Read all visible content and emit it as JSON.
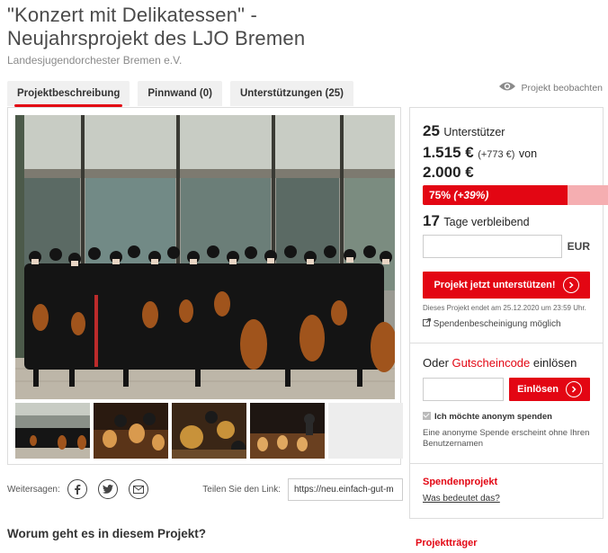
{
  "project": {
    "title_line1": "\"Konzert mit Delikatessen\" -",
    "title_line2": "Neujahrsprojekt des LJO Bremen",
    "organization": "Landesjugendorchester Bremen e.V."
  },
  "tabs": [
    {
      "label": "Projektbeschreibung",
      "active": true
    },
    {
      "label": "Pinnwand (0)",
      "active": false
    },
    {
      "label": "Unterstützungen (25)",
      "active": false
    }
  ],
  "watch": {
    "label": "Projekt beobachten",
    "icon": "eye-icon"
  },
  "stats": {
    "supporters_count": "25",
    "supporters_label": "Unterstützer",
    "amount": "1.515 €",
    "amount_delta": "(+773 €)",
    "of_label": "von",
    "goal": "2.000 €",
    "progress_text": "75%",
    "progress_delta": "(+39%)",
    "progress_fraction": 0.75,
    "progress_delta_fraction": 0.39,
    "days_count": "17",
    "days_label": "Tage verbleibend"
  },
  "donate": {
    "currency": "EUR",
    "button_label": "Projekt jetzt unterstützen!",
    "end_note": "Dieses Projekt endet am 25.12.2020 um 23:59 Uhr.",
    "receipt_label": "Spendenbescheinigung möglich"
  },
  "voucher": {
    "prefix": "Oder",
    "link": "Gutscheincode",
    "suffix": "einlösen",
    "button_label": "Einlösen"
  },
  "anonymous": {
    "label": "Ich möchte anonym spenden",
    "note": "Eine anonyme Spende erscheint ohne Ihren Benutzernamen"
  },
  "spendenprojekt": {
    "title": "Spendenprojekt",
    "link": "Was bedeutet das?"
  },
  "share": {
    "label": "Weitersagen:",
    "link_label": "Teilen Sie den Link:",
    "link_value": "https://neu.einfach-gut-m"
  },
  "section_title": "Worum geht es in diesem Projekt?",
  "traeger_title": "Projektträger",
  "colors": {
    "accent": "#e30613",
    "accent_light": "#f5aeb1"
  }
}
